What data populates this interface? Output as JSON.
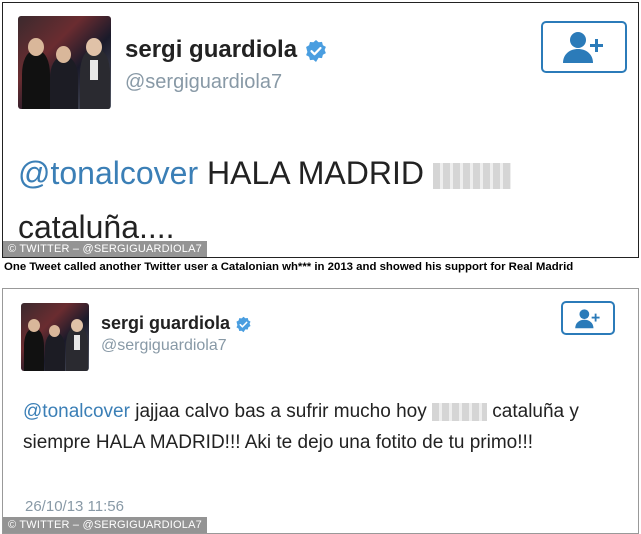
{
  "tweet1": {
    "user_name": "sergi guardiola",
    "handle": "@sergiguardiola7",
    "mention": "@tonalcover",
    "text_line1": " HALA MADRID ",
    "text_line2": "cataluña....",
    "credit": "© TWITTER – @SERGIGUARDIOLA7"
  },
  "caption": "One Tweet called another Twitter user a Catalonian wh*** in 2013 and showed his support for Real Madrid",
  "tweet2": {
    "user_name": "sergi guardiola",
    "handle": "@sergiguardiola7",
    "mention": "@tonalcover",
    "text_part1": " jajjaa calvo bas a sufrir mucho hoy ",
    "text_part2": " cataluña y siempre HALA MADRID!!! Aki te dejo una fotito de tu primo!!!",
    "timestamp": "26/10/13 11:56",
    "credit": "© TWITTER – @SERGIGUARDIOLA7"
  },
  "icons": {
    "verified": "verified-badge-icon",
    "follow": "add-user-icon"
  },
  "colors": {
    "accent": "#2b7bb9",
    "mention": "#3b7fb6",
    "handle": "#8899a6"
  }
}
